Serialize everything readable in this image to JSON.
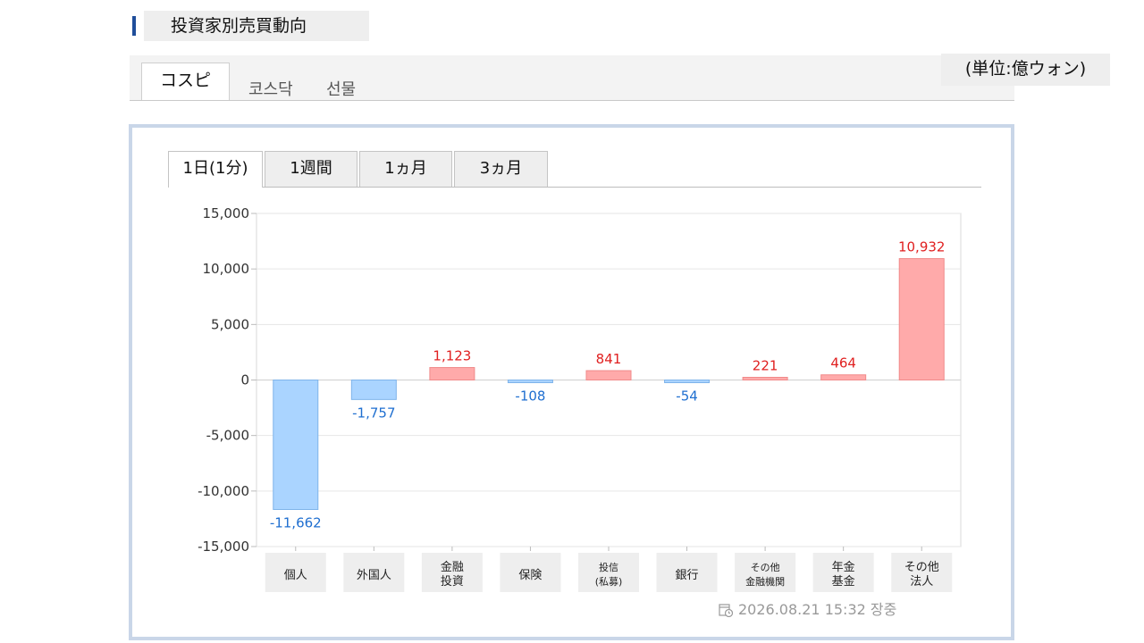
{
  "header": {
    "title": "投資家別売買動向"
  },
  "market_tabs": [
    {
      "label": "コスピ",
      "active": true
    },
    {
      "label": "코스닥",
      "active": false
    },
    {
      "label": "선물",
      "active": false
    }
  ],
  "unit_label": "(単位:億ウォン)",
  "period_tabs": [
    {
      "label": "1日(1分)",
      "active": true
    },
    {
      "label": "1週間",
      "active": false
    },
    {
      "label": "1ヵ月",
      "active": false
    },
    {
      "label": "3ヵ月",
      "active": false
    }
  ],
  "colors": {
    "positive_fill": "#ffaaaa",
    "positive_stroke": "#f08a8a",
    "positive_text": "#e02020",
    "negative_fill": "#aad4ff",
    "negative_stroke": "#7fb4ea",
    "negative_text": "#1f6fd0",
    "accent": "#1f4e9a"
  },
  "chart_data": {
    "type": "bar",
    "categories": [
      [
        "個人"
      ],
      [
        "外国人"
      ],
      [
        "金融",
        "投資"
      ],
      [
        "保険"
      ],
      [
        "投信",
        "(私募)"
      ],
      [
        "銀行"
      ],
      [
        "その他",
        "金融機関"
      ],
      [
        "年金",
        "基金"
      ],
      [
        "その他",
        "法人"
      ]
    ],
    "values": [
      -11662,
      -1757,
      1123,
      -108,
      841,
      -54,
      221,
      464,
      10932
    ],
    "data_labels": [
      "-11,662",
      "-1,757",
      "1,123",
      "-108",
      "841",
      "-54",
      "221",
      "464",
      "10,932"
    ],
    "ylim": [
      -15000,
      15000
    ],
    "yticks": [
      15000,
      10000,
      5000,
      0,
      -5000,
      -10000,
      -15000
    ],
    "ytick_labels": [
      "15,000",
      "10,000",
      "5,000",
      "0",
      "-5,000",
      "-10,000",
      "-15,000"
    ],
    "grid": true,
    "legend": "none"
  },
  "timestamp": {
    "datetime": "2026.08.21 15:32",
    "status": "장중"
  }
}
